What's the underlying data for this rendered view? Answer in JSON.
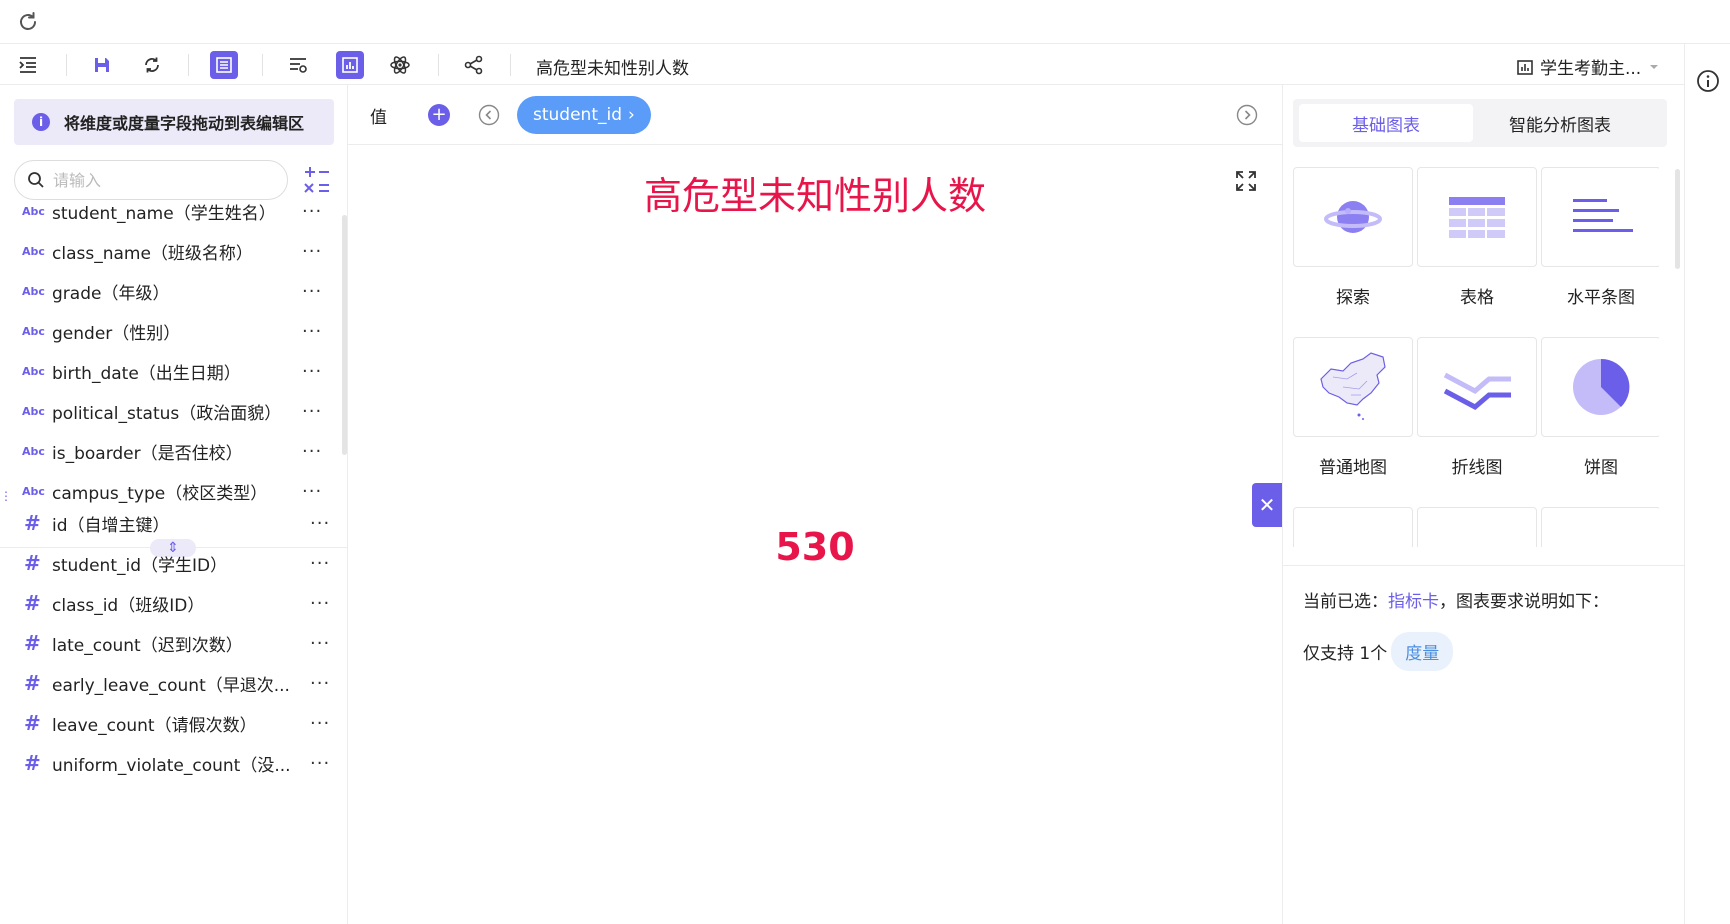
{
  "toolbar": {
    "title": "高危型未知性别人数",
    "dataset_name": "学生考勤主..."
  },
  "left": {
    "hint": "将维度或度量字段拖动到表编辑区",
    "search_placeholder": "请输入",
    "dimension_type_label": "Abc",
    "measure_type_label": "#",
    "more_label": "···",
    "dimensions": [
      "student_name（学生姓名）",
      "class_name（班级名称）",
      "grade（年级）",
      "gender（性别）",
      "birth_date（出生日期）",
      "political_status（政治面貌）",
      "is_boarder（是否住校）",
      "campus_type（校区类型）"
    ],
    "measures": [
      "id（自增主键）",
      "student_id（学生ID）",
      "class_id（班级ID）",
      "late_count（迟到次数）",
      "early_leave_count（早退次...",
      "leave_count（请假次数）",
      "uniform_violate_count（没..."
    ]
  },
  "center": {
    "value_label": "值",
    "pill_label": "student_id",
    "chart_title": "高危型未知性别人数",
    "kpi_value": "530"
  },
  "chartpanel": {
    "tabs": [
      "基础图表",
      "智能分析图表"
    ],
    "charts": [
      "探索",
      "表格",
      "水平条图",
      "普通地图",
      "折线图",
      "饼图"
    ],
    "desc_prefix": "当前已选：",
    "desc_link": "指标卡",
    "desc_suffix": "，图表要求说明如下：",
    "support_prefix": "仅支持 1个",
    "support_tag": "度量"
  },
  "colors": {
    "accent": "#6b5ee8",
    "kpi": "#e8154a",
    "pill": "#5b9cf8"
  }
}
